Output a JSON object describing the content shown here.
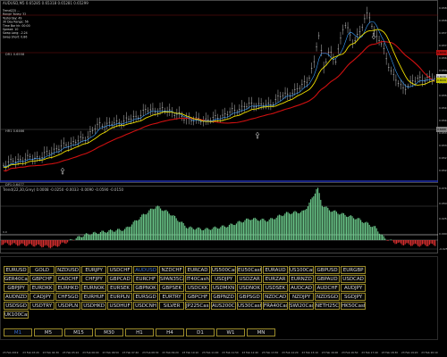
{
  "window": {
    "main_title": "AUDUSD,M5 0.65285 0.65318 0.65281 0.65299",
    "sub_title": "Trend(22,30,Grey) 0.0008 -0.0250 -0.0033 -0.0090 -0.0590 -0.0150"
  },
  "info_panel": {
    "lines": [
      "Trend(22) ...",
      "Range Today: 32",
      "Yesterday: 49",
      "30 Day Range: 56",
      "Time Bar hh: 00:00",
      "Spread: 10",
      "Swap Long: -2.24",
      "Swap Short: 0.86"
    ]
  },
  "levels": [
    {
      "label": "DR1  0.6558",
      "color": "#7a1010"
    },
    {
      "label": "HR1  0.6466",
      "color": "#5a5a5a"
    },
    {
      "label": "DP1  0.6477",
      "color": "#2030b0"
    }
  ],
  "price_axis": [
    "0.6585",
    "0.6580",
    "0.6575",
    "0.6570",
    "0.6565",
    "0.6560",
    "0.6555",
    "0.6550",
    "0.6545",
    "0.6540",
    "0.6535",
    "0.6530",
    "0.6525",
    "0.6520"
  ],
  "price_tags": [
    "0.6558",
    "0.6530",
    "0.6529",
    "0.6466"
  ],
  "oscillator_axis": [
    "0.0740",
    "0.0500",
    "0.0250",
    "0.0000",
    "-0.0250"
  ],
  "time_axis": [
    "23 Feb 2019",
    "23 Feb 03:20",
    "23 Feb 04:30",
    "23 Feb 05:10",
    "23 Feb 06:00",
    "23 Feb 06:50",
    "23 Feb 07:40",
    "23 Feb 08:30",
    "23 Feb 09:20",
    "23 Feb 10:10",
    "23 Feb 11:00",
    "23 Feb 11:50",
    "23 Feb 12:40",
    "23 Feb 13:30",
    "23 Feb 14:20",
    "23 Feb 15:10",
    "23 Feb 16:00",
    "23 Feb 16:50",
    "23 Feb 17:40",
    "23 Feb 18:30",
    "23 Feb 19:20",
    "23 Feb 20:10"
  ],
  "symbols": [
    [
      "EURUSD",
      "GOLD",
      "NZDUSD",
      "EURJPY",
      "USDCHF",
      "AUDUSD",
      "NZDCHF",
      "EURCAD",
      "US500Cash",
      "EU50Cash",
      "EURAUD",
      "US100Cash",
      "GBPUSD",
      "EURGBP"
    ],
    [
      "GER40Cash",
      "GBPCHF",
      "CADCHF",
      "CHFJPY",
      "GBPCAD",
      "EURCHF",
      "SPAN35Cash",
      "IT40Cash",
      "USDJPY",
      "USDZAR",
      "EURZAR",
      "EURNZD",
      "GBPAUD",
      "USDCAD"
    ],
    [
      "GBPJPY",
      "EURDKK",
      "EURHKD",
      "EURNOK",
      "EURSEK",
      "GBPNOK",
      "GBPSEK",
      "USDCKK",
      "USDMXN",
      "USDNOK",
      "USDSEK",
      "AUDCAD",
      "AUDCHF",
      "AUDJPY"
    ],
    [
      "AUDNZD",
      "CADJPY",
      "CHFSGD",
      "EURHUF",
      "EURPLN",
      "EURSGD",
      "EURTRY",
      "GBPCHF",
      "GBPNZD",
      "GBPSGD",
      "NZDCAD",
      "NZDJPY",
      "NZDSGD",
      "SGDJPY"
    ],
    [
      "USDSGD",
      "USDTRY",
      "USDPLN",
      "USDHKD",
      "USDHUF",
      "USDCNH",
      "SILVER",
      "JP225Cash",
      "AUS200Cash",
      "US30Cash",
      "FRA40Cash",
      "SWI20Cash",
      "NETH25Cash",
      "HK50Cash"
    ],
    [
      "UK100Cash"
    ]
  ],
  "active_symbol": "AUDUSD",
  "timeframes": [
    "M1",
    "M5",
    "M15",
    "M30",
    "H1",
    "H4",
    "D1",
    "W1",
    "MN"
  ],
  "active_timeframe": "M1",
  "colors": {
    "candle": "#cfcfcf",
    "ma_fast": "#f0e000",
    "ma_slow": "#d01010",
    "ma_blue": "#3aa0ff",
    "hist_pos": "#6fcf8f",
    "hist_neg": "#e03030",
    "level_low": "#2030b0"
  }
}
